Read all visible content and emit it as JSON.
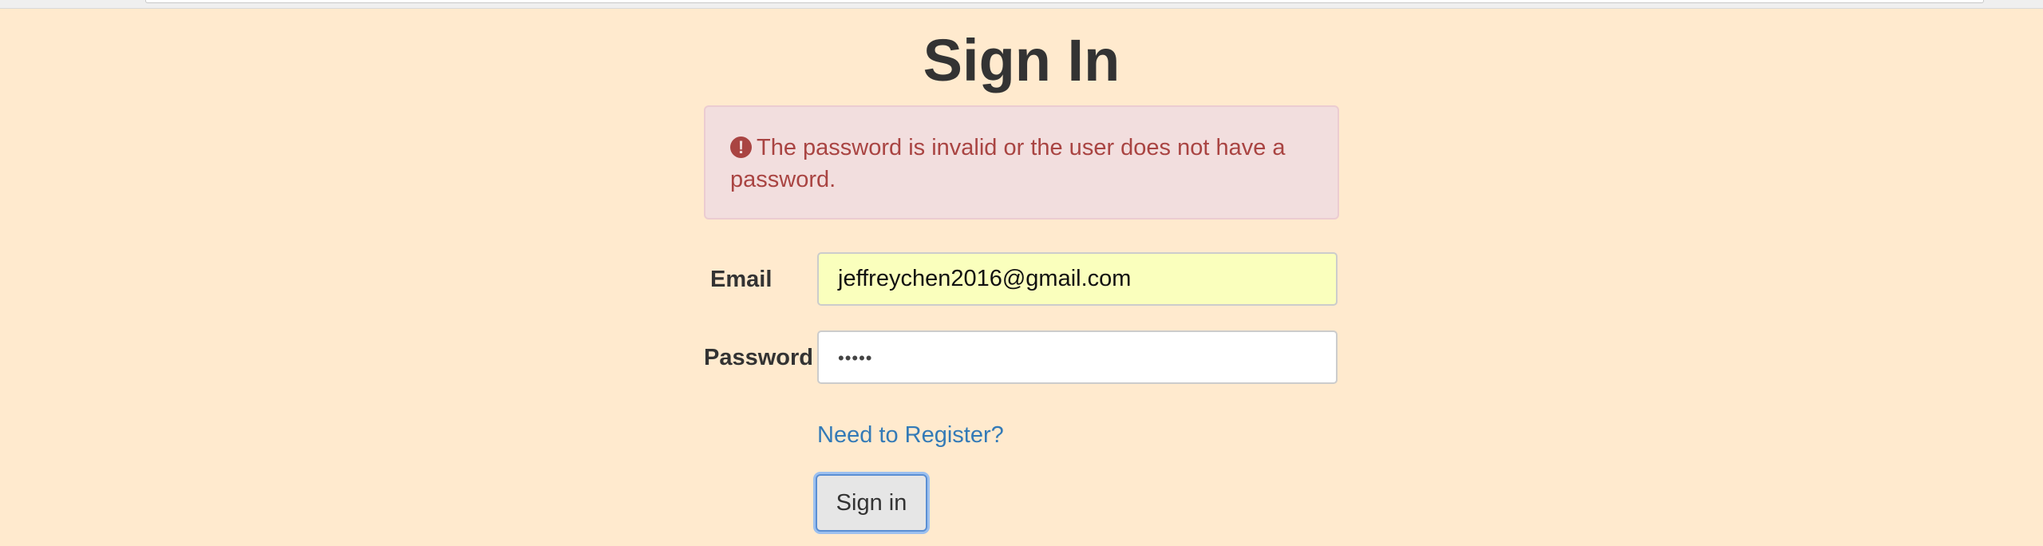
{
  "page": {
    "title": "Sign In"
  },
  "alert": {
    "icon": "exclamation-circle-icon",
    "message": "The password is invalid or the user does not have a password."
  },
  "form": {
    "email_label": "Email",
    "email_value": "jeffreychen2016@gmail.com",
    "password_label": "Password",
    "password_masked": "•••••",
    "register_link": "Need to Register?",
    "submit_label": "Sign in"
  },
  "colors": {
    "background": "#ffeace",
    "alert_bg": "#f2dede",
    "alert_text": "#a94442",
    "autofill_bg": "#faffbd",
    "link": "#337ab7"
  }
}
